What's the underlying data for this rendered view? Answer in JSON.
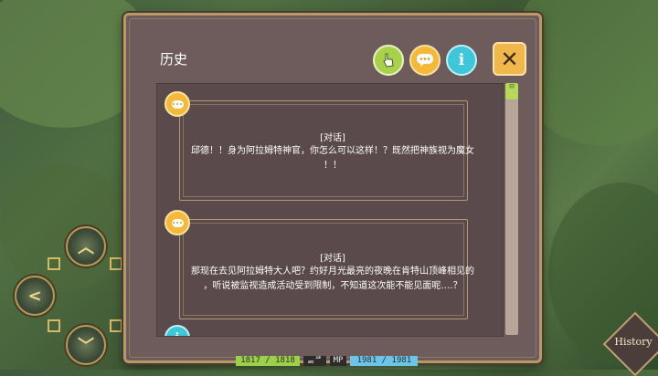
{
  "dialog": {
    "title": "历史",
    "buttons": {
      "filter_icon": "hand-pointer-icon",
      "dialogue_icon": "speech-bubble-icon",
      "info_label": "i",
      "close_label": "✕"
    }
  },
  "entries": [
    {
      "type": "dialogue",
      "speaker": "[对话]",
      "lines": [
        "邱德！！身为阿拉姆特神官，你怎么可以这样！？既然把神族视为魔女",
        "！！"
      ]
    },
    {
      "type": "dialogue",
      "speaker": "[对话]",
      "lines": [
        "那现在去见阿拉姆特大人吧？约好月光最亮的夜晚在肯特山顶峰相见的",
        "，听说被监视造成活动受到限制，不知道这次能不能见面呢….？"
      ]
    },
    {
      "type": "info",
      "label": "i"
    }
  ],
  "scroll": {
    "thumb_label": "≡"
  },
  "history_button": {
    "label": "History"
  },
  "status": {
    "hp": "1817 / 1818",
    "tag": "ᆱᄹ",
    "mp_label": "MP",
    "mp": "1981 / 1981"
  },
  "colors": {
    "panel": "#6e5c5d",
    "border_gold": "#b89a66",
    "accent_yellow": "#f5b93a",
    "accent_green": "#a9d24a",
    "accent_cyan": "#3ec7d9"
  }
}
